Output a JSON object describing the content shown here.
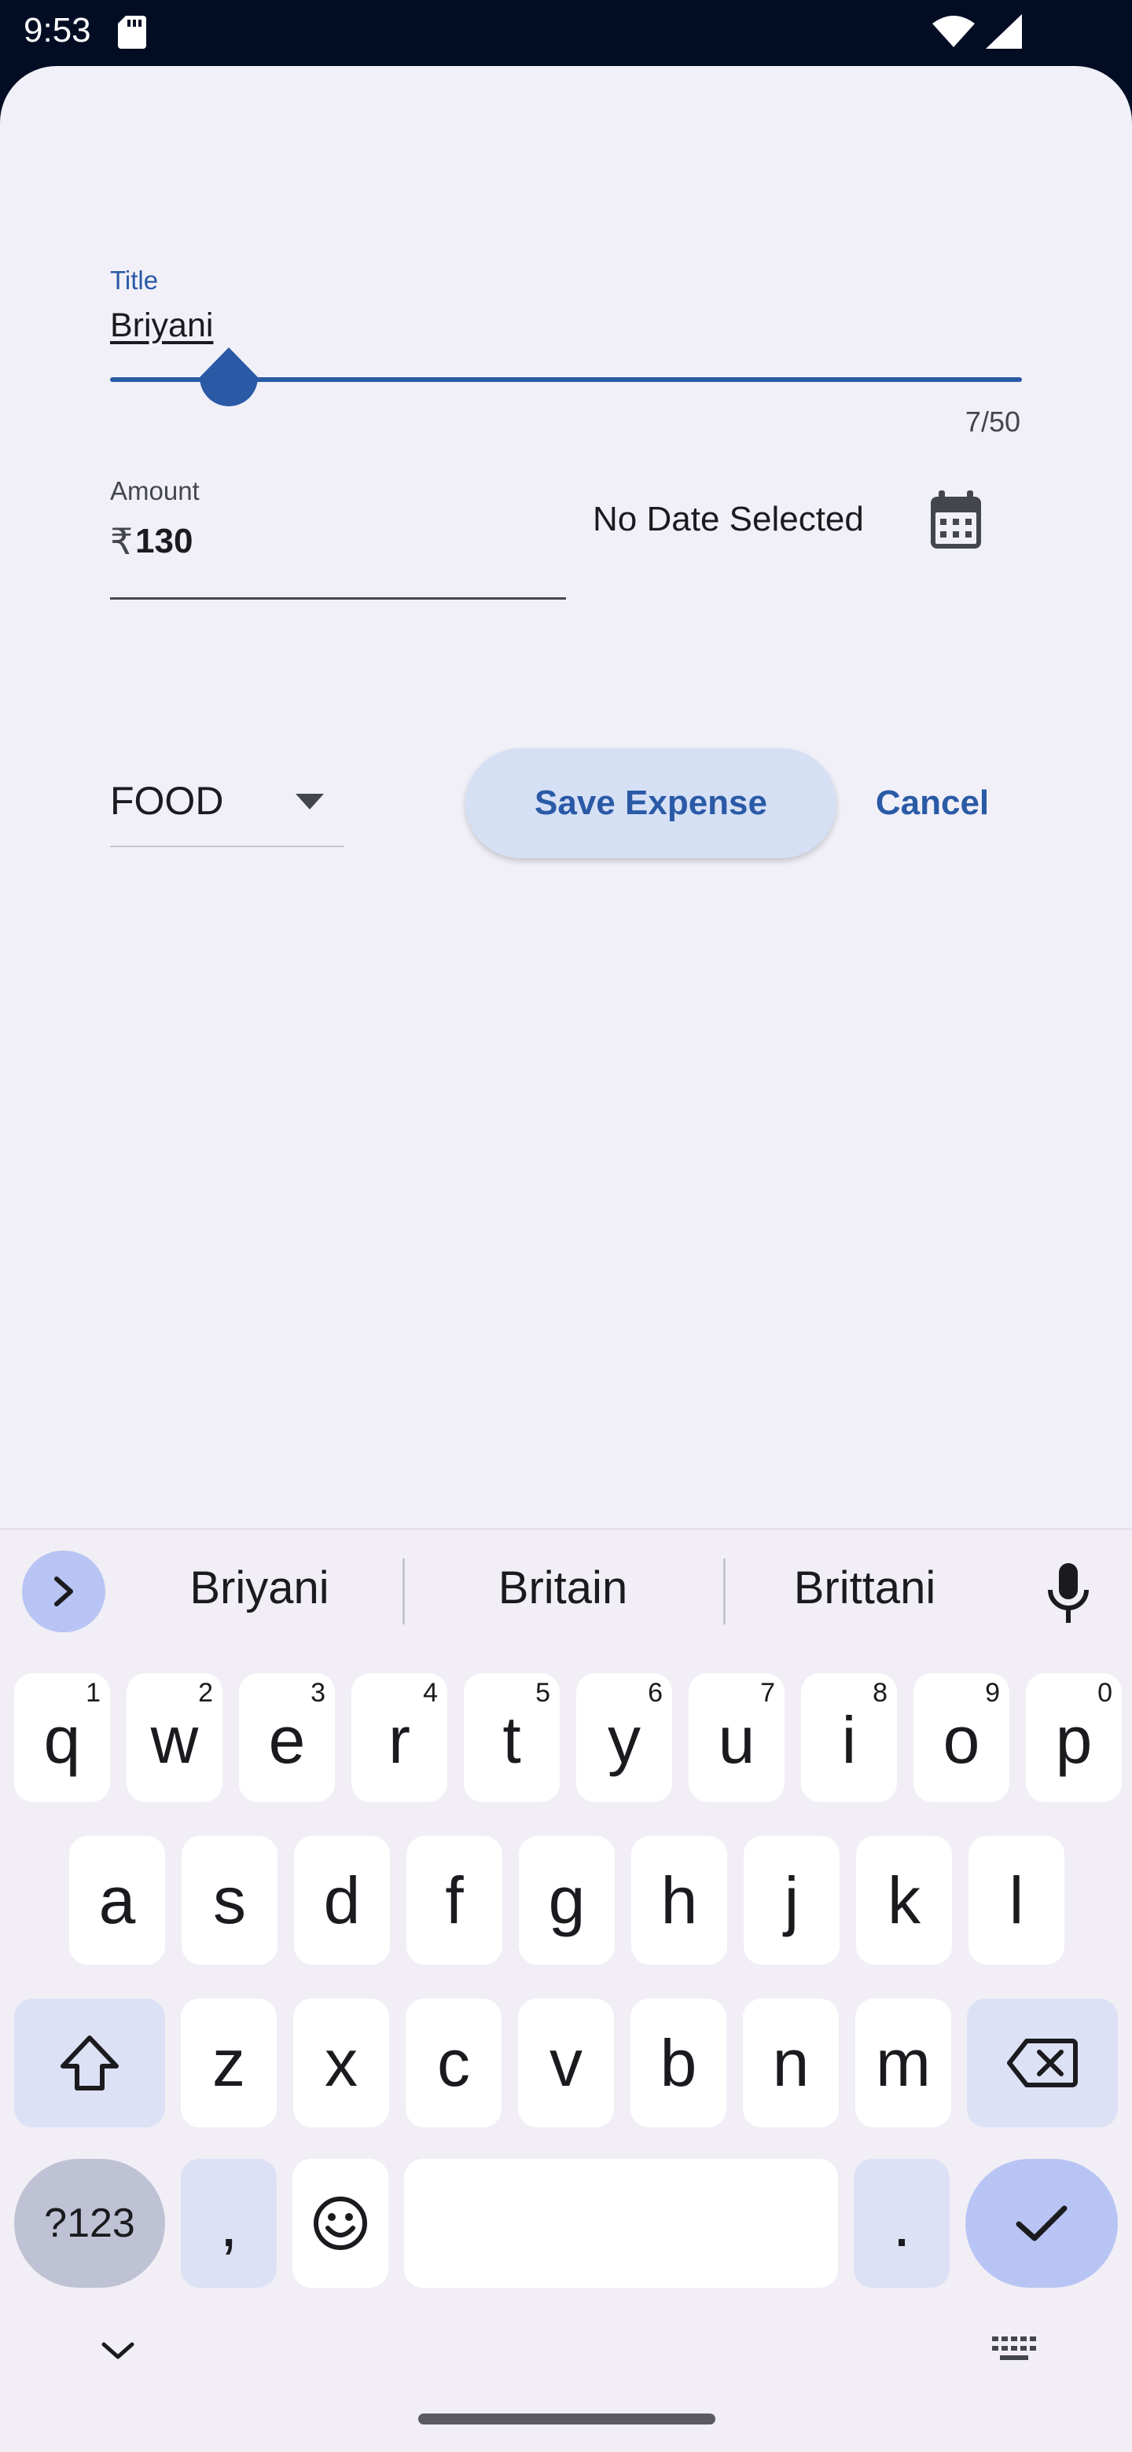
{
  "status_bar": {
    "time": "9:53"
  },
  "form": {
    "title_label": "Title",
    "title_value": "Briyani",
    "title_counter": "7/50",
    "amount_label": "Amount",
    "amount_prefix": "₹",
    "amount_value": "130",
    "date_text": "No Date Selected",
    "category_value": "FOOD",
    "save_label": "Save Expense",
    "cancel_label": "Cancel"
  },
  "keyboard": {
    "suggestions": [
      "Briyani",
      "Britain",
      "Brittani"
    ],
    "row1": [
      {
        "k": "q",
        "h": "1"
      },
      {
        "k": "w",
        "h": "2"
      },
      {
        "k": "e",
        "h": "3"
      },
      {
        "k": "r",
        "h": "4"
      },
      {
        "k": "t",
        "h": "5"
      },
      {
        "k": "y",
        "h": "6"
      },
      {
        "k": "u",
        "h": "7"
      },
      {
        "k": "i",
        "h": "8"
      },
      {
        "k": "o",
        "h": "9"
      },
      {
        "k": "p",
        "h": "0"
      }
    ],
    "row2": [
      "a",
      "s",
      "d",
      "f",
      "g",
      "h",
      "j",
      "k",
      "l"
    ],
    "row3": [
      "z",
      "x",
      "c",
      "v",
      "b",
      "n",
      "m"
    ],
    "symbols_label": "?123",
    "comma_label": ",",
    "period_label": "."
  },
  "colors": {
    "accent": "#2a5aa6",
    "sheet_bg": "#f1f0f8",
    "save_bg": "#d6e0f5",
    "status_bg": "#020d24"
  }
}
